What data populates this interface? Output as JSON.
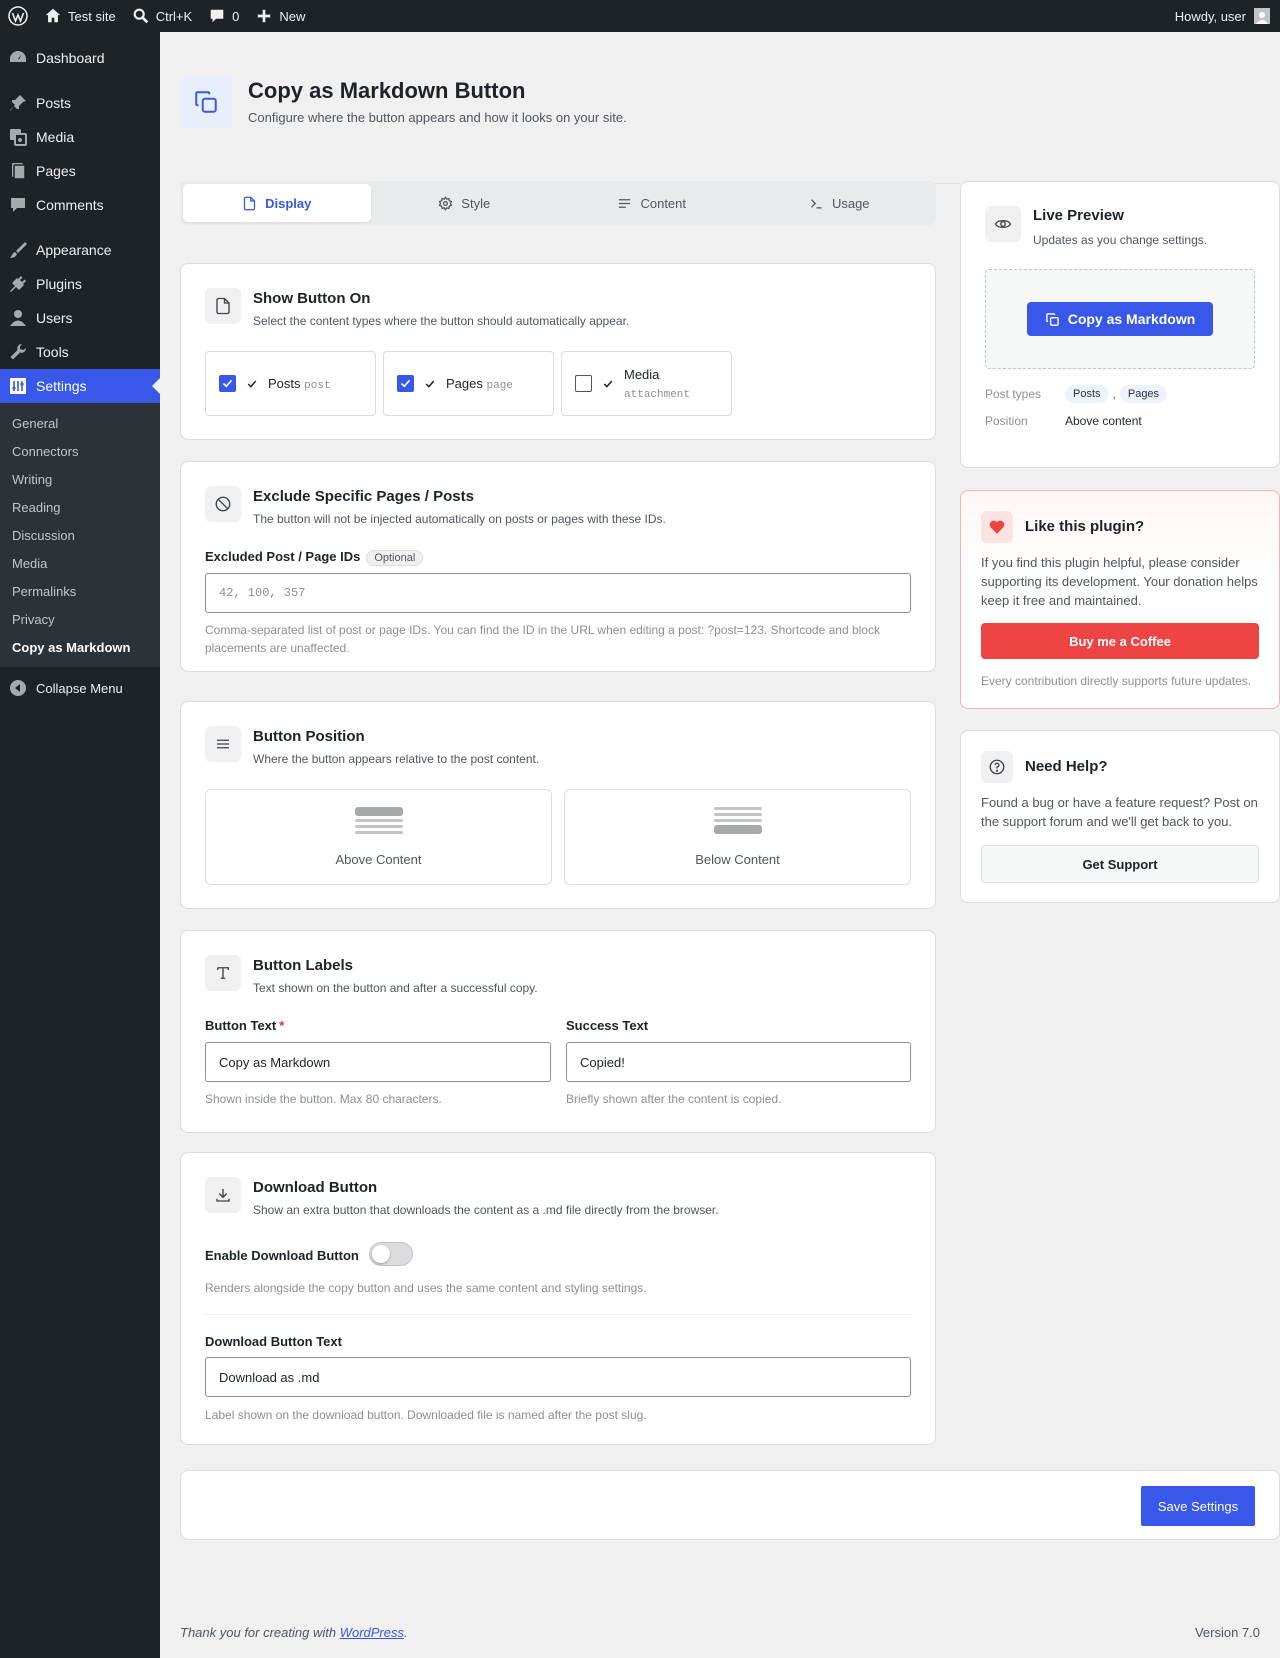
{
  "adminbar": {
    "site_name": "Test site",
    "search_shortcut": "Ctrl+K",
    "comments_count": "0",
    "new_label": "New",
    "howdy": "Howdy, user"
  },
  "sidebar": {
    "items": [
      {
        "label": "Dashboard"
      },
      {
        "label": "Posts"
      },
      {
        "label": "Media"
      },
      {
        "label": "Pages"
      },
      {
        "label": "Comments"
      },
      {
        "label": "Appearance"
      },
      {
        "label": "Plugins"
      },
      {
        "label": "Users"
      },
      {
        "label": "Tools"
      },
      {
        "label": "Settings"
      }
    ],
    "submenu": [
      "General",
      "Connectors",
      "Writing",
      "Reading",
      "Discussion",
      "Media",
      "Permalinks",
      "Privacy",
      "Copy as Markdown"
    ],
    "collapse": "Collapse Menu"
  },
  "header": {
    "title": "Copy as Markdown Button",
    "subtitle": "Configure where the button appears and how it looks on your site."
  },
  "tabs": [
    {
      "label": "Display",
      "icon": "document-icon",
      "active": true
    },
    {
      "label": "Style",
      "icon": "gear-icon"
    },
    {
      "label": "Content",
      "icon": "lines-icon"
    },
    {
      "label": "Usage",
      "icon": "terminal-icon"
    }
  ],
  "show_on": {
    "title": "Show Button On",
    "subtitle": "Select the content types where the button should automatically appear.",
    "options": [
      {
        "label": "Posts",
        "slug": "post",
        "checked": true
      },
      {
        "label": "Pages",
        "slug": "page",
        "checked": true
      },
      {
        "label": "Media",
        "slug": "attachment",
        "checked": false
      }
    ]
  },
  "exclude": {
    "title": "Exclude Specific Pages / Posts",
    "subtitle": "The button will not be injected automatically on posts or pages with these IDs.",
    "field_label": "Excluded Post / Page IDs",
    "badge": "Optional",
    "placeholder": "42, 100, 357",
    "help": "Comma-separated list of post or page IDs. You can find the ID in the URL when editing a post: ?post=123. Shortcode and block placements are unaffected."
  },
  "position": {
    "title": "Button Position",
    "subtitle": "Where the button appears relative to the post content.",
    "above": "Above Content",
    "below": "Below Content"
  },
  "labels": {
    "title": "Button Labels",
    "subtitle": "Text shown on the button and after a successful copy.",
    "button_text_label": "Button Text",
    "button_text_value": "Copy as Markdown",
    "button_text_help": "Shown inside the button. Max 80 characters.",
    "success_label": "Success Text",
    "success_value": "Copied!",
    "success_help": "Briefly shown after the content is copied."
  },
  "download": {
    "title": "Download Button",
    "subtitle": "Show an extra button that downloads the content as a .md file directly from the browser.",
    "enable_label": "Enable Download Button",
    "enabled": false,
    "enable_help": "Renders alongside the copy button and uses the same content and styling settings.",
    "text_label": "Download Button Text",
    "text_value": "Download as .md",
    "text_help": "Label shown on the download button. Downloaded file is named after the post slug."
  },
  "preview": {
    "title": "Live Preview",
    "subtitle": "Updates as you change settings.",
    "button_label": "Copy as Markdown",
    "post_types_label": "Post types",
    "post_types": [
      "Posts",
      "Pages"
    ],
    "separator": ",",
    "position_label": "Position",
    "position_value": "Above content"
  },
  "like": {
    "title": "Like this plugin?",
    "body": "If you find this plugin helpful, please consider supporting its development. Your donation helps keep it free and maintained.",
    "button": "Buy me a Coffee",
    "note": "Every contribution directly supports future updates."
  },
  "help": {
    "title": "Need Help?",
    "body": "Found a bug or have a feature request? Post on the support forum and we'll get back to you.",
    "button": "Get Support"
  },
  "save_button": "Save Settings",
  "footer": {
    "thanks_prefix": "Thank you for creating with",
    "thanks_link": "WordPress",
    "thanks_suffix": ".",
    "version": "Version 7.0"
  },
  "colors": {
    "accent": "#3858e9",
    "danger": "#ef4444",
    "adminbar": "#1d2327"
  }
}
